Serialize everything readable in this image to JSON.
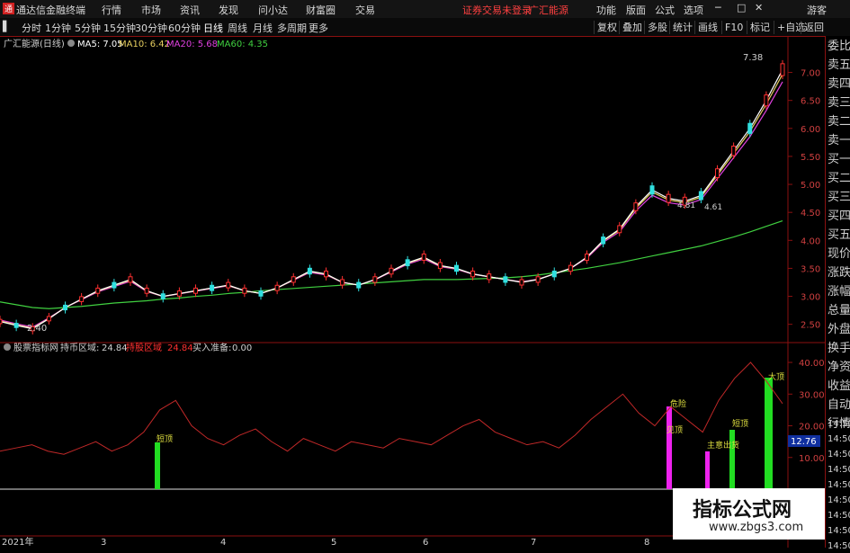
{
  "app": {
    "title": "通达信金融终端",
    "menu": [
      "行情",
      "市场",
      "资讯",
      "发现",
      "问小达",
      "财富圈",
      "交易"
    ],
    "status_notice": "证券交易未登录",
    "stock_name_top": "广汇能源",
    "right_menu": [
      "功能",
      "版面",
      "公式",
      "选项"
    ],
    "guest": "游客"
  },
  "toolbar": {
    "periods": [
      "分时",
      "1分钟",
      "5分钟",
      "15分钟",
      "30分钟",
      "60分钟",
      "日线",
      "周线",
      "月线",
      "多周期",
      "更多"
    ],
    "active_period": "日线",
    "right_buttons": [
      "复权",
      "叠加",
      "多股",
      "统计",
      "画线",
      "F10",
      "标记",
      "+自选",
      "返回"
    ]
  },
  "main_chart": {
    "stock_label": "广汇能源(日线)",
    "ma": [
      {
        "label": "MA5: 7.05",
        "color": "#ffffff"
      },
      {
        "label": "MA10: 6.42",
        "color": "#e8d060"
      },
      {
        "label": "MA20: 5.68",
        "color": "#e040e0"
      },
      {
        "label": "MA60: 4.35",
        "color": "#40d040"
      }
    ],
    "high_label": "7.38",
    "low_label": "2.40",
    "y_ticks": [
      "7.00",
      "6.50",
      "6.00",
      "5.50",
      "5.00",
      "4.50",
      "4.00",
      "3.50",
      "3.00",
      "2.50"
    ],
    "annotations": [
      "4.81",
      "4.61"
    ]
  },
  "indicator": {
    "name": "股票指标网",
    "holding_label": "持币区域:",
    "holding_value": "24.84",
    "position_label": "持股区域",
    "position_value": "24.84",
    "buy_label": "买入准备:",
    "buy_value": "0.00",
    "y_ticks": [
      "40.00",
      "30.00",
      "20.00",
      "10.00"
    ],
    "current_value": "12.76",
    "signals": [
      "短顶",
      "危险",
      "见顶",
      "主意出货",
      "短顶",
      "大顶"
    ]
  },
  "x_axis": {
    "labels": [
      "2021年",
      "3",
      "4",
      "5",
      "6",
      "7",
      "8"
    ]
  },
  "right_panel": {
    "items": [
      "委比",
      "卖五",
      "卖四",
      "卖三",
      "卖二",
      "卖一",
      "买一",
      "买二",
      "买三",
      "买四",
      "买五",
      "现价",
      "涨跌",
      "涨幅",
      "总量",
      "外盘",
      "换手",
      "净资",
      "收益",
      "自动",
      "行情"
    ],
    "times": [
      "14:50",
      "14:50",
      "14:50",
      "14:50",
      "14:50",
      "14:50",
      "14:50",
      "14:50",
      "14:50"
    ]
  },
  "watermark": {
    "title": "指标公式网",
    "url": "www.zbgs3.com"
  },
  "chart_data": {
    "type": "line",
    "ma5": [
      2.55,
      2.48,
      2.42,
      2.6,
      2.8,
      2.95,
      3.1,
      3.2,
      3.3,
      3.1,
      3.0,
      3.05,
      3.1,
      3.15,
      3.2,
      3.1,
      3.05,
      3.15,
      3.3,
      3.45,
      3.4,
      3.25,
      3.2,
      3.3,
      3.45,
      3.6,
      3.7,
      3.55,
      3.5,
      3.4,
      3.35,
      3.3,
      3.25,
      3.3,
      3.4,
      3.5,
      3.7,
      4.0,
      4.2,
      4.6,
      4.9,
      4.75,
      4.7,
      4.8,
      5.2,
      5.6,
      6.0,
      6.5,
      7.05
    ],
    "ma60": [
      2.9,
      2.85,
      2.8,
      2.78,
      2.8,
      2.82,
      2.85,
      2.88,
      2.9,
      2.92,
      2.95,
      2.97,
      3.0,
      3.02,
      3.05,
      3.07,
      3.1,
      3.12,
      3.14,
      3.16,
      3.18,
      3.2,
      3.22,
      3.24,
      3.26,
      3.28,
      3.3,
      3.3,
      3.3,
      3.31,
      3.32,
      3.33,
      3.35,
      3.38,
      3.42,
      3.46,
      3.5,
      3.55,
      3.6,
      3.66,
      3.72,
      3.78,
      3.84,
      3.9,
      3.98,
      4.06,
      4.15,
      4.25,
      4.35
    ],
    "indicator": [
      12,
      13,
      14,
      12,
      11,
      13,
      15,
      12,
      14,
      18,
      25,
      28,
      20,
      16,
      14,
      17,
      19,
      15,
      12,
      16,
      14,
      12,
      15,
      14,
      13,
      16,
      15,
      14,
      17,
      20,
      22,
      18,
      16,
      14,
      15,
      13,
      17,
      22,
      26,
      30,
      24,
      20,
      26,
      22,
      18,
      28,
      35,
      40,
      34,
      27
    ]
  }
}
